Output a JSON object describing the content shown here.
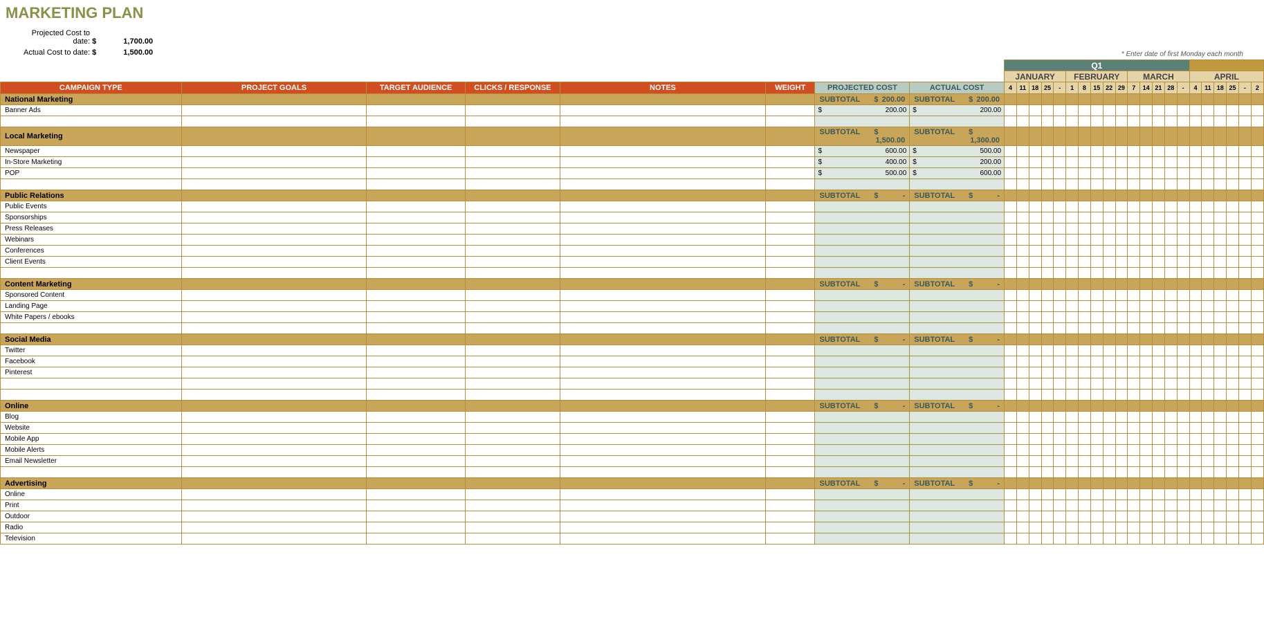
{
  "title": "MARKETING PLAN",
  "summary": {
    "projected_label": "Projected Cost to date:",
    "projected_cur": "$",
    "projected_val": "1,700.00",
    "actual_label": "Actual Cost to date:",
    "actual_cur": "$",
    "actual_val": "1,500.00"
  },
  "hint": "* Enter date of first Monday each month",
  "quarters": {
    "q1": "Q1"
  },
  "months": [
    "JANUARY",
    "FEBRUARY",
    "MARCH",
    "APRIL"
  ],
  "days": {
    "jan": [
      "4",
      "11",
      "18",
      "25",
      "-"
    ],
    "feb": [
      "1",
      "8",
      "15",
      "22",
      "29"
    ],
    "mar": [
      "7",
      "14",
      "21",
      "28",
      "-"
    ],
    "apr": [
      "4",
      "11",
      "18",
      "25",
      "-",
      "2"
    ]
  },
  "headers": {
    "campaign": "CAMPAIGN TYPE",
    "goals": "PROJECT GOALS",
    "audience": "TARGET AUDIENCE",
    "clicks": "CLICKS / RESPONSE",
    "notes": "NOTES",
    "weight": "WEIGHT",
    "projected": "PROJECTED COST",
    "actual": "ACTUAL COST"
  },
  "subtotal_label": "SUBTOTAL",
  "currency": "$",
  "dash": "-",
  "sections": [
    {
      "name": "National Marketing",
      "projected": "200.00",
      "actual": "200.00",
      "rows": [
        {
          "label": "Banner Ads",
          "projected": "200.00",
          "actual": "200.00"
        },
        {
          "label": ""
        }
      ]
    },
    {
      "name": "Local Marketing",
      "projected": "1,500.00",
      "actual": "1,300.00",
      "rows": [
        {
          "label": "Newspaper",
          "projected": "600.00",
          "actual": "500.00"
        },
        {
          "label": "In-Store Marketing",
          "projected": "400.00",
          "actual": "200.00"
        },
        {
          "label": "POP",
          "projected": "500.00",
          "actual": "600.00"
        },
        {
          "label": ""
        }
      ]
    },
    {
      "name": "Public Relations",
      "projected": "-",
      "actual": "-",
      "rows": [
        {
          "label": "Public Events"
        },
        {
          "label": "Sponsorships"
        },
        {
          "label": "Press Releases"
        },
        {
          "label": "Webinars"
        },
        {
          "label": "Conferences"
        },
        {
          "label": "Client Events"
        },
        {
          "label": ""
        }
      ]
    },
    {
      "name": "Content Marketing",
      "projected": "-",
      "actual": "-",
      "rows": [
        {
          "label": "Sponsored Content"
        },
        {
          "label": "Landing Page"
        },
        {
          "label": "White Papers / ebooks"
        },
        {
          "label": ""
        }
      ]
    },
    {
      "name": "Social Media",
      "projected": "-",
      "actual": "-",
      "rows": [
        {
          "label": "Twitter"
        },
        {
          "label": "Facebook"
        },
        {
          "label": "Pinterest"
        },
        {
          "label": ""
        },
        {
          "label": ""
        }
      ]
    },
    {
      "name": "Online",
      "projected": "-",
      "actual": "-",
      "rows": [
        {
          "label": "Blog"
        },
        {
          "label": "Website"
        },
        {
          "label": "Mobile App"
        },
        {
          "label": "Mobile Alerts"
        },
        {
          "label": "Email Newsletter"
        },
        {
          "label": ""
        }
      ]
    },
    {
      "name": "Advertising",
      "projected": "-",
      "actual": "-",
      "rows": [
        {
          "label": "Online"
        },
        {
          "label": "Print"
        },
        {
          "label": "Outdoor"
        },
        {
          "label": "Radio"
        },
        {
          "label": "Television"
        }
      ]
    }
  ]
}
